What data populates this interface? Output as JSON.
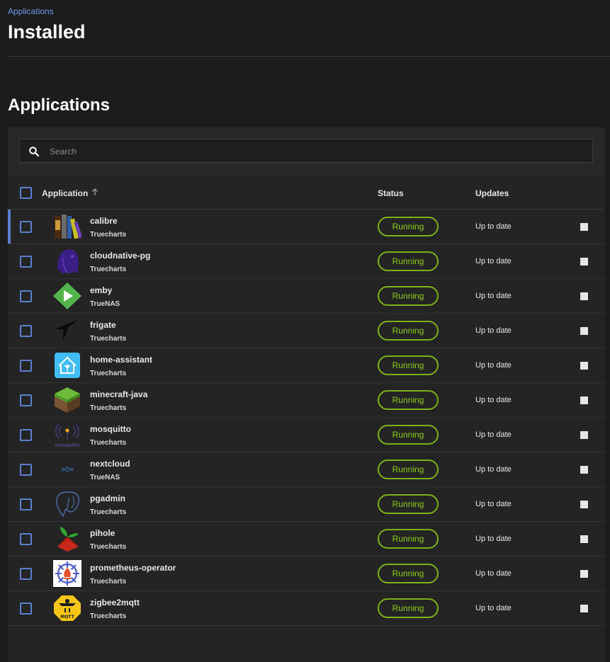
{
  "breadcrumb": "Applications",
  "page_title": "Installed",
  "section_title": "Applications",
  "search": {
    "placeholder": "Search"
  },
  "table": {
    "columns": {
      "application": "Application",
      "status": "Status",
      "updates": "Updates"
    },
    "rows": [
      {
        "name": "calibre",
        "train": "Truecharts",
        "status": "Running",
        "update": "Up to date",
        "icon": "calibre-icon"
      },
      {
        "name": "cloudnative-pg",
        "train": "Truecharts",
        "status": "Running",
        "update": "Up to date",
        "icon": "cloudnative-pg-icon"
      },
      {
        "name": "emby",
        "train": "TrueNAS",
        "status": "Running",
        "update": "Up to date",
        "icon": "emby-icon"
      },
      {
        "name": "frigate",
        "train": "Truecharts",
        "status": "Running",
        "update": "Up to date",
        "icon": "frigate-icon"
      },
      {
        "name": "home-assistant",
        "train": "Truecharts",
        "status": "Running",
        "update": "Up to date",
        "icon": "home-assistant-icon"
      },
      {
        "name": "minecraft-java",
        "train": "Truecharts",
        "status": "Running",
        "update": "Up to date",
        "icon": "minecraft-icon"
      },
      {
        "name": "mosquitto",
        "train": "Truecharts",
        "status": "Running",
        "update": "Up to date",
        "icon": "mosquitto-icon",
        "icon_text": "mosquitto"
      },
      {
        "name": "nextcloud",
        "train": "TrueNAS",
        "status": "Running",
        "update": "Up to date",
        "icon": "nextcloud-icon"
      },
      {
        "name": "pgadmin",
        "train": "Truecharts",
        "status": "Running",
        "update": "Up to date",
        "icon": "pgadmin-icon"
      },
      {
        "name": "pihole",
        "train": "Truecharts",
        "status": "Running",
        "update": "Up to date",
        "icon": "pihole-icon"
      },
      {
        "name": "prometheus-operator",
        "train": "Truecharts",
        "status": "Running",
        "update": "Up to date",
        "icon": "prometheus-icon"
      },
      {
        "name": "zigbee2mqtt",
        "train": "Truecharts",
        "status": "Running",
        "update": "Up to date",
        "icon": "zigbee2mqtt-icon",
        "icon_text": "MQTT"
      }
    ]
  },
  "colors": {
    "accent": "#5b7fd1",
    "running": "#7ab317",
    "link": "#6e9ae6"
  }
}
